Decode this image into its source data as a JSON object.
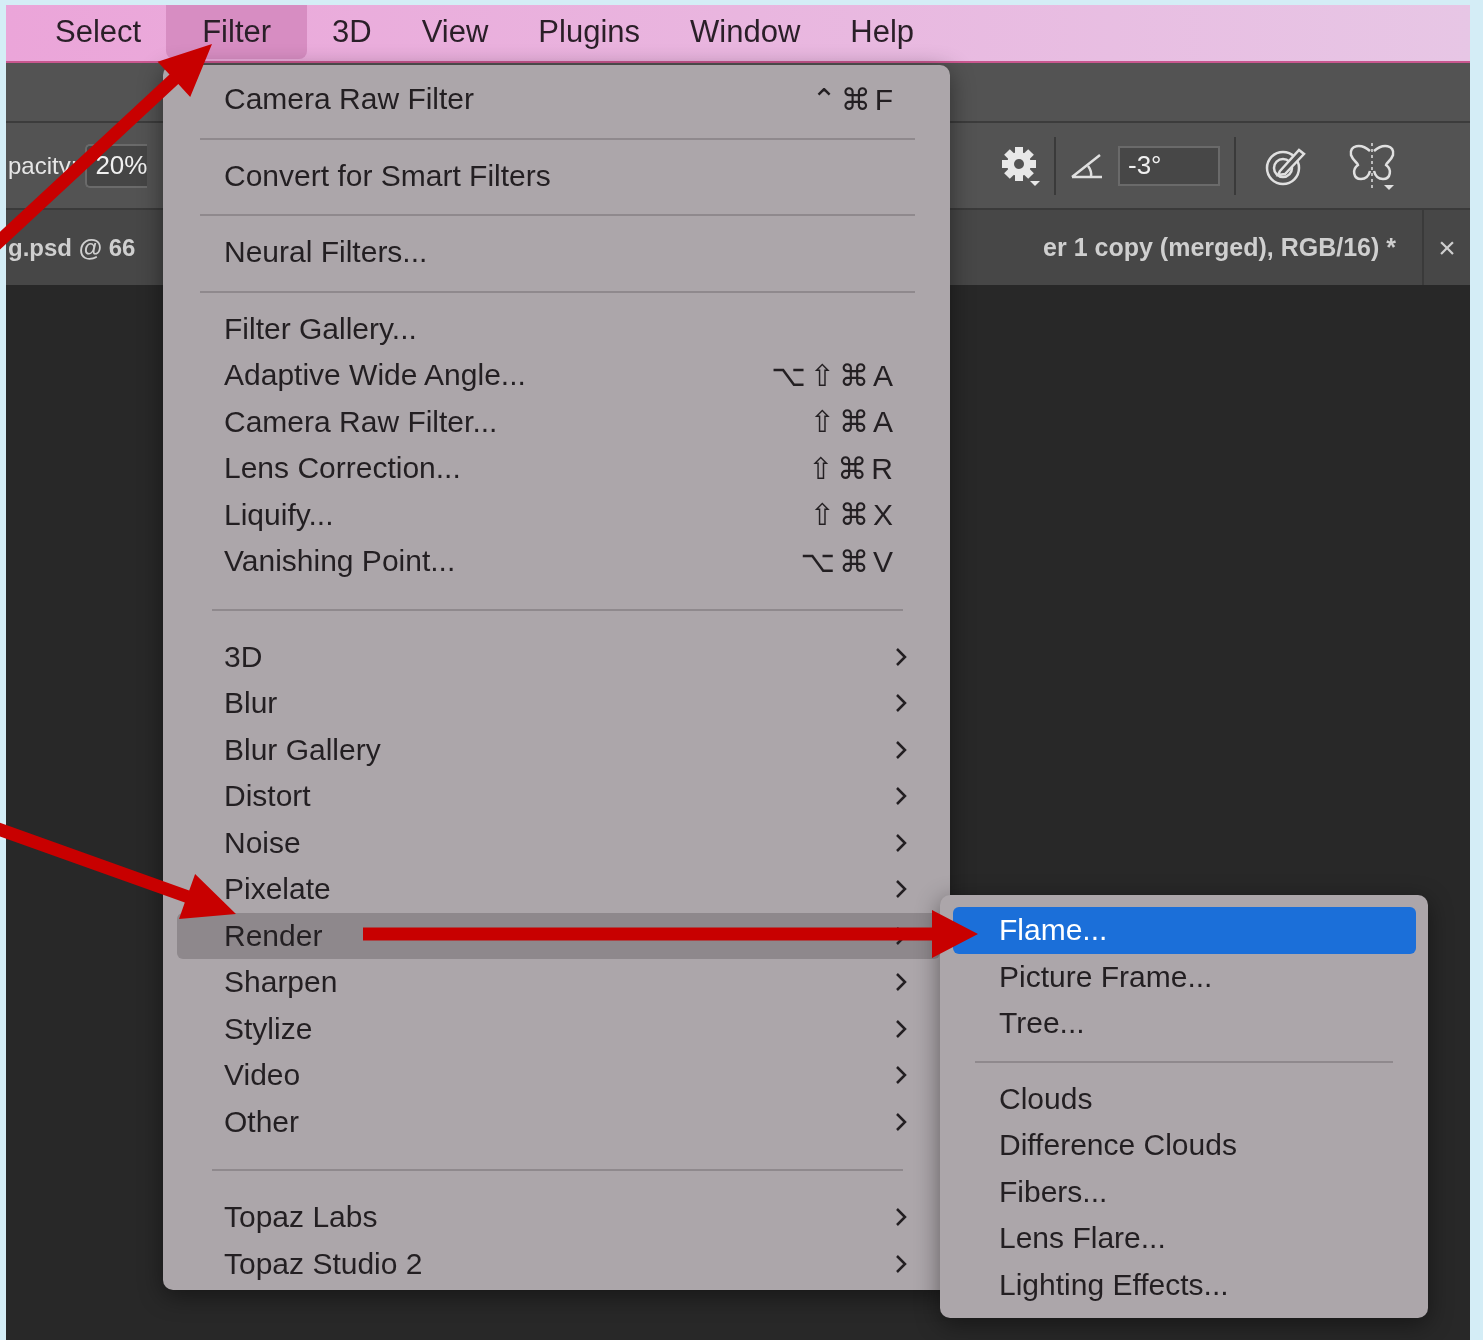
{
  "menubar": {
    "items": [
      {
        "label": "Select",
        "selected": false
      },
      {
        "label": "Filter",
        "selected": true
      },
      {
        "label": "3D",
        "selected": false
      },
      {
        "label": "View",
        "selected": false
      },
      {
        "label": "Plugins",
        "selected": false
      },
      {
        "label": "Window",
        "selected": false
      },
      {
        "label": "Help",
        "selected": false
      }
    ]
  },
  "options_bar": {
    "opacity_label": "pacity:",
    "opacity_value": "20%",
    "angle_value": "-3°"
  },
  "document_tabs": [
    {
      "title": "g.psd @ 66"
    },
    {
      "title": "er 1 copy (merged), RGB/16) *",
      "close": "×"
    }
  ],
  "filter_menu": {
    "sections": [
      [
        {
          "label": "Camera Raw Filter",
          "shortcut": "⌃⌘F",
          "submenu": false,
          "selected": false
        }
      ],
      [
        {
          "label": "Convert for Smart Filters",
          "submenu": false,
          "selected": false
        }
      ],
      [
        {
          "label": "Neural Filters...",
          "submenu": false,
          "selected": false
        }
      ],
      [
        {
          "label": "Filter Gallery...",
          "submenu": false,
          "selected": false
        },
        {
          "label": "Adaptive Wide Angle...",
          "shortcut": "⌥⇧⌘A",
          "submenu": false,
          "selected": false
        },
        {
          "label": "Camera Raw Filter...",
          "shortcut": "⇧⌘A",
          "submenu": false,
          "selected": false
        },
        {
          "label": "Lens Correction...",
          "shortcut": "⇧⌘R",
          "submenu": false,
          "selected": false
        },
        {
          "label": "Liquify...",
          "shortcut": "⇧⌘X",
          "submenu": false,
          "selected": false
        },
        {
          "label": "Vanishing Point...",
          "shortcut": "⌥⌘V",
          "submenu": false,
          "selected": false
        }
      ],
      [
        {
          "label": "3D",
          "submenu": true,
          "selected": false
        },
        {
          "label": "Blur",
          "submenu": true,
          "selected": false
        },
        {
          "label": "Blur Gallery",
          "submenu": true,
          "selected": false
        },
        {
          "label": "Distort",
          "submenu": true,
          "selected": false
        },
        {
          "label": "Noise",
          "submenu": true,
          "selected": false
        },
        {
          "label": "Pixelate",
          "submenu": true,
          "selected": false
        },
        {
          "label": "Render",
          "submenu": true,
          "selected": true
        },
        {
          "label": "Sharpen",
          "submenu": true,
          "selected": false
        },
        {
          "label": "Stylize",
          "submenu": true,
          "selected": false
        },
        {
          "label": "Video",
          "submenu": true,
          "selected": false
        },
        {
          "label": "Other",
          "submenu": true,
          "selected": false
        }
      ],
      [
        {
          "label": "Topaz Labs",
          "submenu": true,
          "selected": false
        },
        {
          "label": "Topaz Studio 2",
          "submenu": true,
          "selected": false
        }
      ]
    ]
  },
  "render_submenu": {
    "sections": [
      [
        {
          "label": "Flame...",
          "selected": true
        },
        {
          "label": "Picture Frame...",
          "selected": false
        },
        {
          "label": "Tree...",
          "selected": false
        }
      ],
      [
        {
          "label": "Clouds",
          "selected": false
        },
        {
          "label": "Difference Clouds",
          "selected": false
        },
        {
          "label": "Fibers...",
          "selected": false
        },
        {
          "label": "Lens Flare...",
          "selected": false
        },
        {
          "label": "Lighting Effects...",
          "selected": false
        }
      ]
    ]
  }
}
